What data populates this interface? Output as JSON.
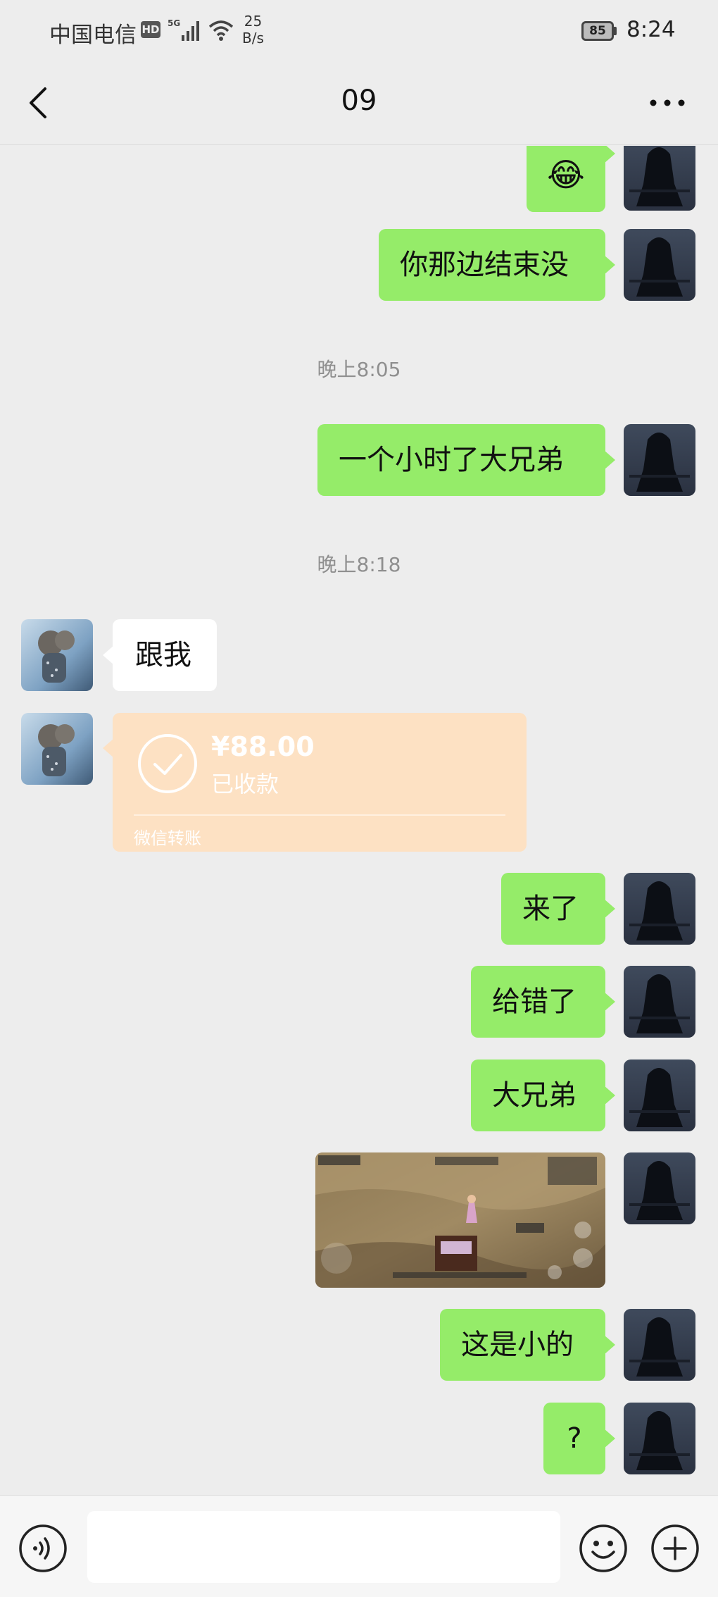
{
  "status_bar": {
    "carrier": "中国电信",
    "hd_badge": "HD",
    "network": "5G",
    "speed_value": "25",
    "speed_unit": "B/s",
    "battery": "85",
    "time": "8:24"
  },
  "header": {
    "title": "09",
    "back_icon": "chevron-left-icon",
    "more_icon": "more-dots-icon"
  },
  "messages": [
    {
      "type": "emoji",
      "side": "out",
      "content": "😂"
    },
    {
      "type": "text",
      "side": "out",
      "content": "你那边结束没"
    },
    {
      "type": "time",
      "content": "晚上8:05"
    },
    {
      "type": "text",
      "side": "out",
      "content": "一个小时了大兄弟"
    },
    {
      "type": "time",
      "content": "晚上8:18"
    },
    {
      "type": "text",
      "side": "in",
      "content": "跟我"
    },
    {
      "type": "transfer",
      "side": "in",
      "amount": "¥88.00",
      "status": "已收款",
      "footer": "微信转账"
    },
    {
      "type": "text",
      "side": "out",
      "content": "来了"
    },
    {
      "type": "text",
      "side": "out",
      "content": "给错了"
    },
    {
      "type": "text",
      "side": "out",
      "content": "大兄弟"
    },
    {
      "type": "image",
      "side": "out",
      "content": "game-screenshot"
    },
    {
      "type": "text",
      "side": "out",
      "content": "这是小的"
    },
    {
      "type": "text",
      "side": "out",
      "content": "?"
    }
  ],
  "input_bar": {
    "voice_icon": "voice-icon",
    "placeholder": "",
    "emoji_icon": "emoji-icon",
    "plus_icon": "plus-icon"
  },
  "colors": {
    "background": "#ededed",
    "bubble_out": "#95ec69",
    "bubble_in": "#ffffff",
    "transfer": "#fde1c3",
    "timestamp": "#8f8f8f"
  }
}
